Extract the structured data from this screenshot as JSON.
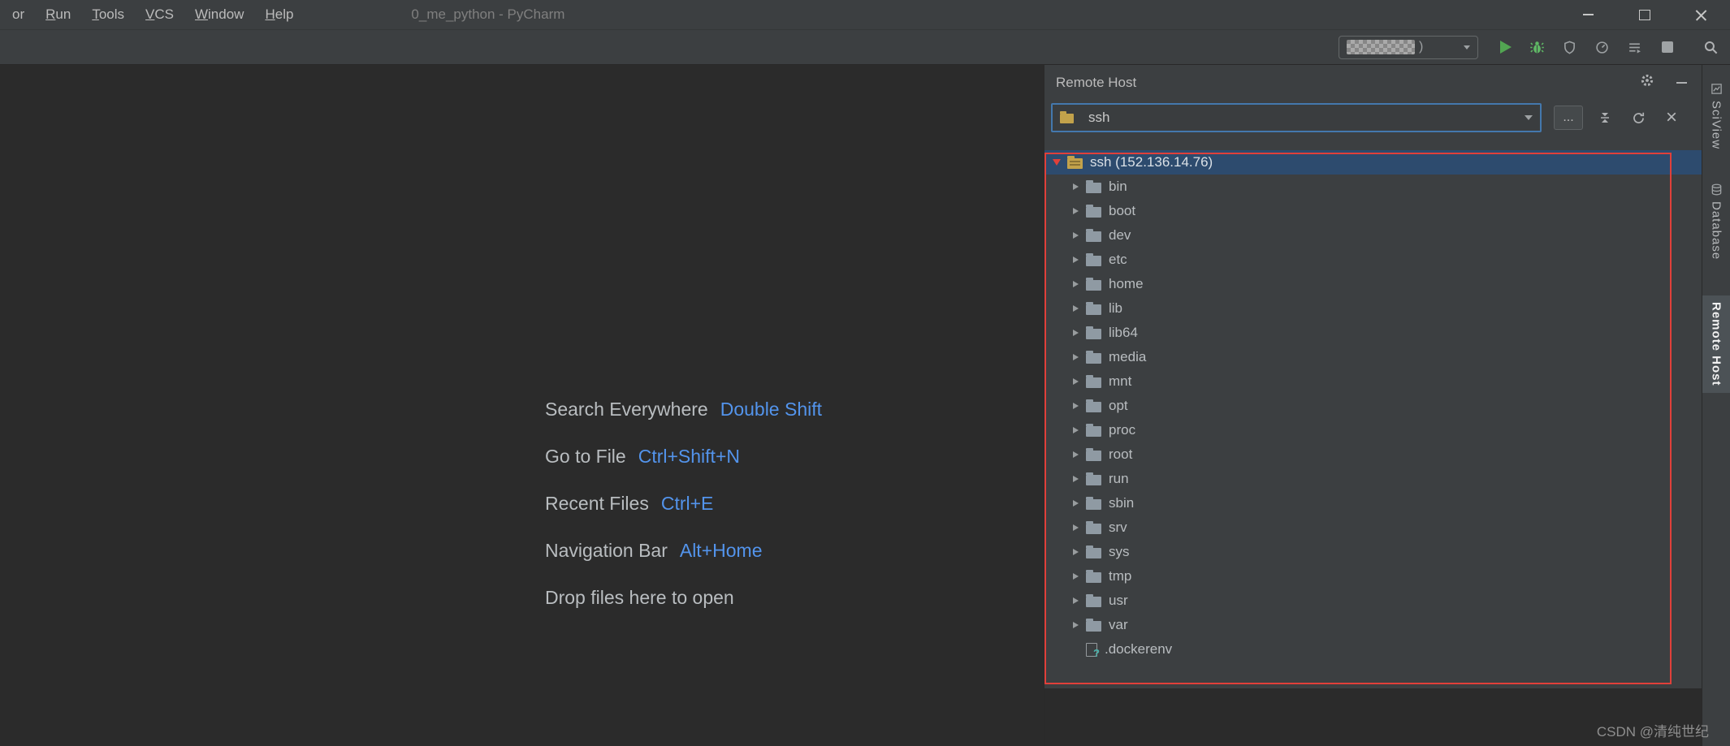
{
  "titlebar": {
    "title": "0_me_python - PyCharm",
    "menu": [
      "or",
      "Run",
      "Tools",
      "VCS",
      "Window",
      "Help"
    ]
  },
  "toolbar": {
    "run_config_suffix": ")"
  },
  "editor": {
    "shortcuts": [
      {
        "label": "Search Everywhere",
        "keys": "Double Shift"
      },
      {
        "label": "Go to File",
        "keys": "Ctrl+Shift+N"
      },
      {
        "label": "Recent Files",
        "keys": "Ctrl+E"
      },
      {
        "label": "Navigation Bar",
        "keys": "Alt+Home"
      }
    ],
    "drop_hint": "Drop files here to open"
  },
  "remote_host": {
    "title": "Remote Host",
    "connection_value": "ssh",
    "browse_label": "...",
    "tree": {
      "root": "ssh (152.136.14.76)",
      "folders": [
        "bin",
        "boot",
        "dev",
        "etc",
        "home",
        "lib",
        "lib64",
        "media",
        "mnt",
        "opt",
        "proc",
        "root",
        "run",
        "sbin",
        "srv",
        "sys",
        "tmp",
        "usr",
        "var"
      ],
      "file": ".dockerenv"
    }
  },
  "right_tabs": [
    "SciView",
    "Database",
    "Remote Host"
  ],
  "watermark": "CSDN @清纯世纪",
  "icons": {
    "close_glyph": "×"
  },
  "colors": {
    "editor_bg": "#2b2b2b",
    "panel_bg": "#3c3f41",
    "accent_blue": "#5394ec",
    "selection_blue": "#2d4b6e",
    "annotation_red": "#e0403a",
    "combo_focus_blue": "#4478ad",
    "run_green": "#5fb865",
    "text_gray": "#bbbbbb"
  }
}
